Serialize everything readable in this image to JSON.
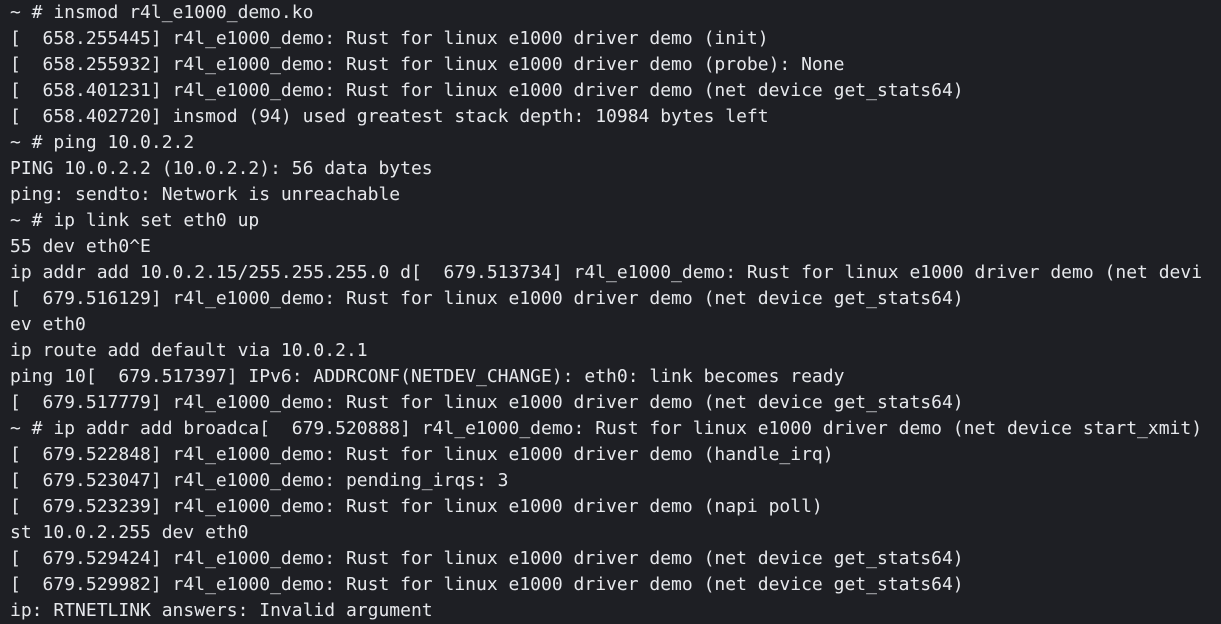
{
  "terminal": {
    "lines": [
      "~ # insmod r4l_e1000_demo.ko",
      "[  658.255445] r4l_e1000_demo: Rust for linux e1000 driver demo (init)",
      "[  658.255932] r4l_e1000_demo: Rust for linux e1000 driver demo (probe): None",
      "[  658.401231] r4l_e1000_demo: Rust for linux e1000 driver demo (net device get_stats64)",
      "[  658.402720] insmod (94) used greatest stack depth: 10984 bytes left",
      "~ # ping 10.0.2.2",
      "PING 10.0.2.2 (10.0.2.2): 56 data bytes",
      "ping: sendto: Network is unreachable",
      "~ # ip link set eth0 up",
      "55 dev eth0^E",
      "ip addr add 10.0.2.15/255.255.255.0 d[  679.513734] r4l_e1000_demo: Rust for linux e1000 driver demo (net devi",
      "[  679.516129] r4l_e1000_demo: Rust for linux e1000 driver demo (net device get_stats64)",
      "ev eth0",
      "ip route add default via 10.0.2.1",
      "ping 10[  679.517397] IPv6: ADDRCONF(NETDEV_CHANGE): eth0: link becomes ready",
      "[  679.517779] r4l_e1000_demo: Rust for linux e1000 driver demo (net device get_stats64)",
      "~ # ip addr add broadca[  679.520888] r4l_e1000_demo: Rust for linux e1000 driver demo (net device start_xmit)",
      "[  679.522848] r4l_e1000_demo: Rust for linux e1000 driver demo (handle_irq)",
      "[  679.523047] r4l_e1000_demo: pending_irqs: 3",
      "[  679.523239] r4l_e1000_demo: Rust for linux e1000 driver demo (napi poll)",
      "st 10.0.2.255 dev eth0",
      "[  679.529424] r4l_e1000_demo: Rust for linux e1000 driver demo (net device get_stats64)",
      "[  679.529982] r4l_e1000_demo: Rust for linux e1000 driver demo (net device get_stats64)",
      "ip: RTNETLINK answers: Invalid argument"
    ],
    "colors": {
      "background": "#1e1f24",
      "foreground": "#e6e8ec"
    }
  }
}
